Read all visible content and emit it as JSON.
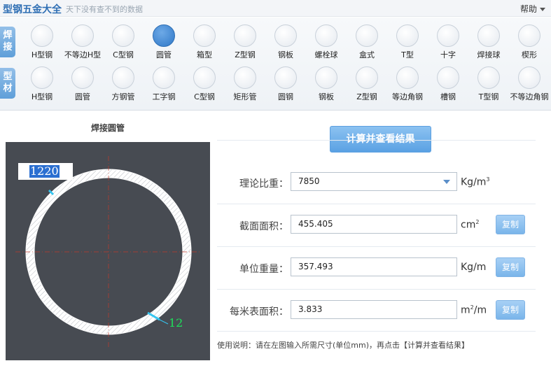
{
  "app": {
    "title": "型钢五金大全",
    "slogan": "天下没有查不到的数据",
    "help_label": "帮助"
  },
  "toolbar": {
    "group_weld": "焊接",
    "group_profile": "型材",
    "weld_items": [
      {
        "label": "H型钢",
        "icon": "h-beam-icon"
      },
      {
        "label": "不等边H型",
        "icon": "unequal-h-beam-icon"
      },
      {
        "label": "C型钢",
        "icon": "c-channel-icon"
      },
      {
        "label": "圆管",
        "icon": "round-tube-icon",
        "active": true
      },
      {
        "label": "箱型",
        "icon": "box-section-icon"
      },
      {
        "label": "Z型钢",
        "icon": "z-section-icon"
      },
      {
        "label": "钢板",
        "icon": "steel-plate-icon"
      },
      {
        "label": "螺栓球",
        "icon": "bolt-ball-icon"
      },
      {
        "label": "盒式",
        "icon": "box-type-icon"
      },
      {
        "label": "T型",
        "icon": "t-section-icon"
      },
      {
        "label": "十字",
        "icon": "cross-section-icon"
      },
      {
        "label": "焊接球",
        "icon": "welded-ball-icon"
      },
      {
        "label": "楔形",
        "icon": "wedge-icon"
      }
    ],
    "profile_items": [
      {
        "label": "H型钢",
        "icon": "h-beam-icon"
      },
      {
        "label": "圆管",
        "icon": "round-tube-icon"
      },
      {
        "label": "方钢管",
        "icon": "square-tube-icon"
      },
      {
        "label": "工字钢",
        "icon": "i-beam-icon"
      },
      {
        "label": "C型钢",
        "icon": "c-channel-icon"
      },
      {
        "label": "矩形管",
        "icon": "rect-tube-icon"
      },
      {
        "label": "圆钢",
        "icon": "round-bar-icon"
      },
      {
        "label": "钢板",
        "icon": "steel-plate-icon"
      },
      {
        "label": "Z型钢",
        "icon": "z-section-icon"
      },
      {
        "label": "等边角钢",
        "icon": "equal-angle-icon"
      },
      {
        "label": "槽钢",
        "icon": "channel-icon"
      },
      {
        "label": "T型钢",
        "icon": "t-section-icon"
      },
      {
        "label": "不等边角钢",
        "icon": "unequal-angle-icon"
      }
    ]
  },
  "left": {
    "title": "焊接圆管",
    "diameter": "1220",
    "thickness": "12"
  },
  "right": {
    "calc_button": "计算并查看结果",
    "density": {
      "label": "理论比重：",
      "value": "7850",
      "unit": "Kg/m",
      "unit_sup": "3"
    },
    "area": {
      "label": "截面面积：",
      "value": "455.405",
      "unit": "cm",
      "unit_sup": "2",
      "copy": "复制"
    },
    "unit_weight": {
      "label": "单位重量：",
      "value": "357.493",
      "unit": "Kg/m",
      "copy": "复制"
    },
    "surface": {
      "label": "每米表面积：",
      "value": "3.833",
      "unit": "m",
      "unit_sup": "2",
      "unit_suffix": "/m",
      "copy": "复制"
    },
    "usage": "使用说明：请在左图输入所需尺寸(单位mm)，再点击【计算并查看结果】"
  }
}
